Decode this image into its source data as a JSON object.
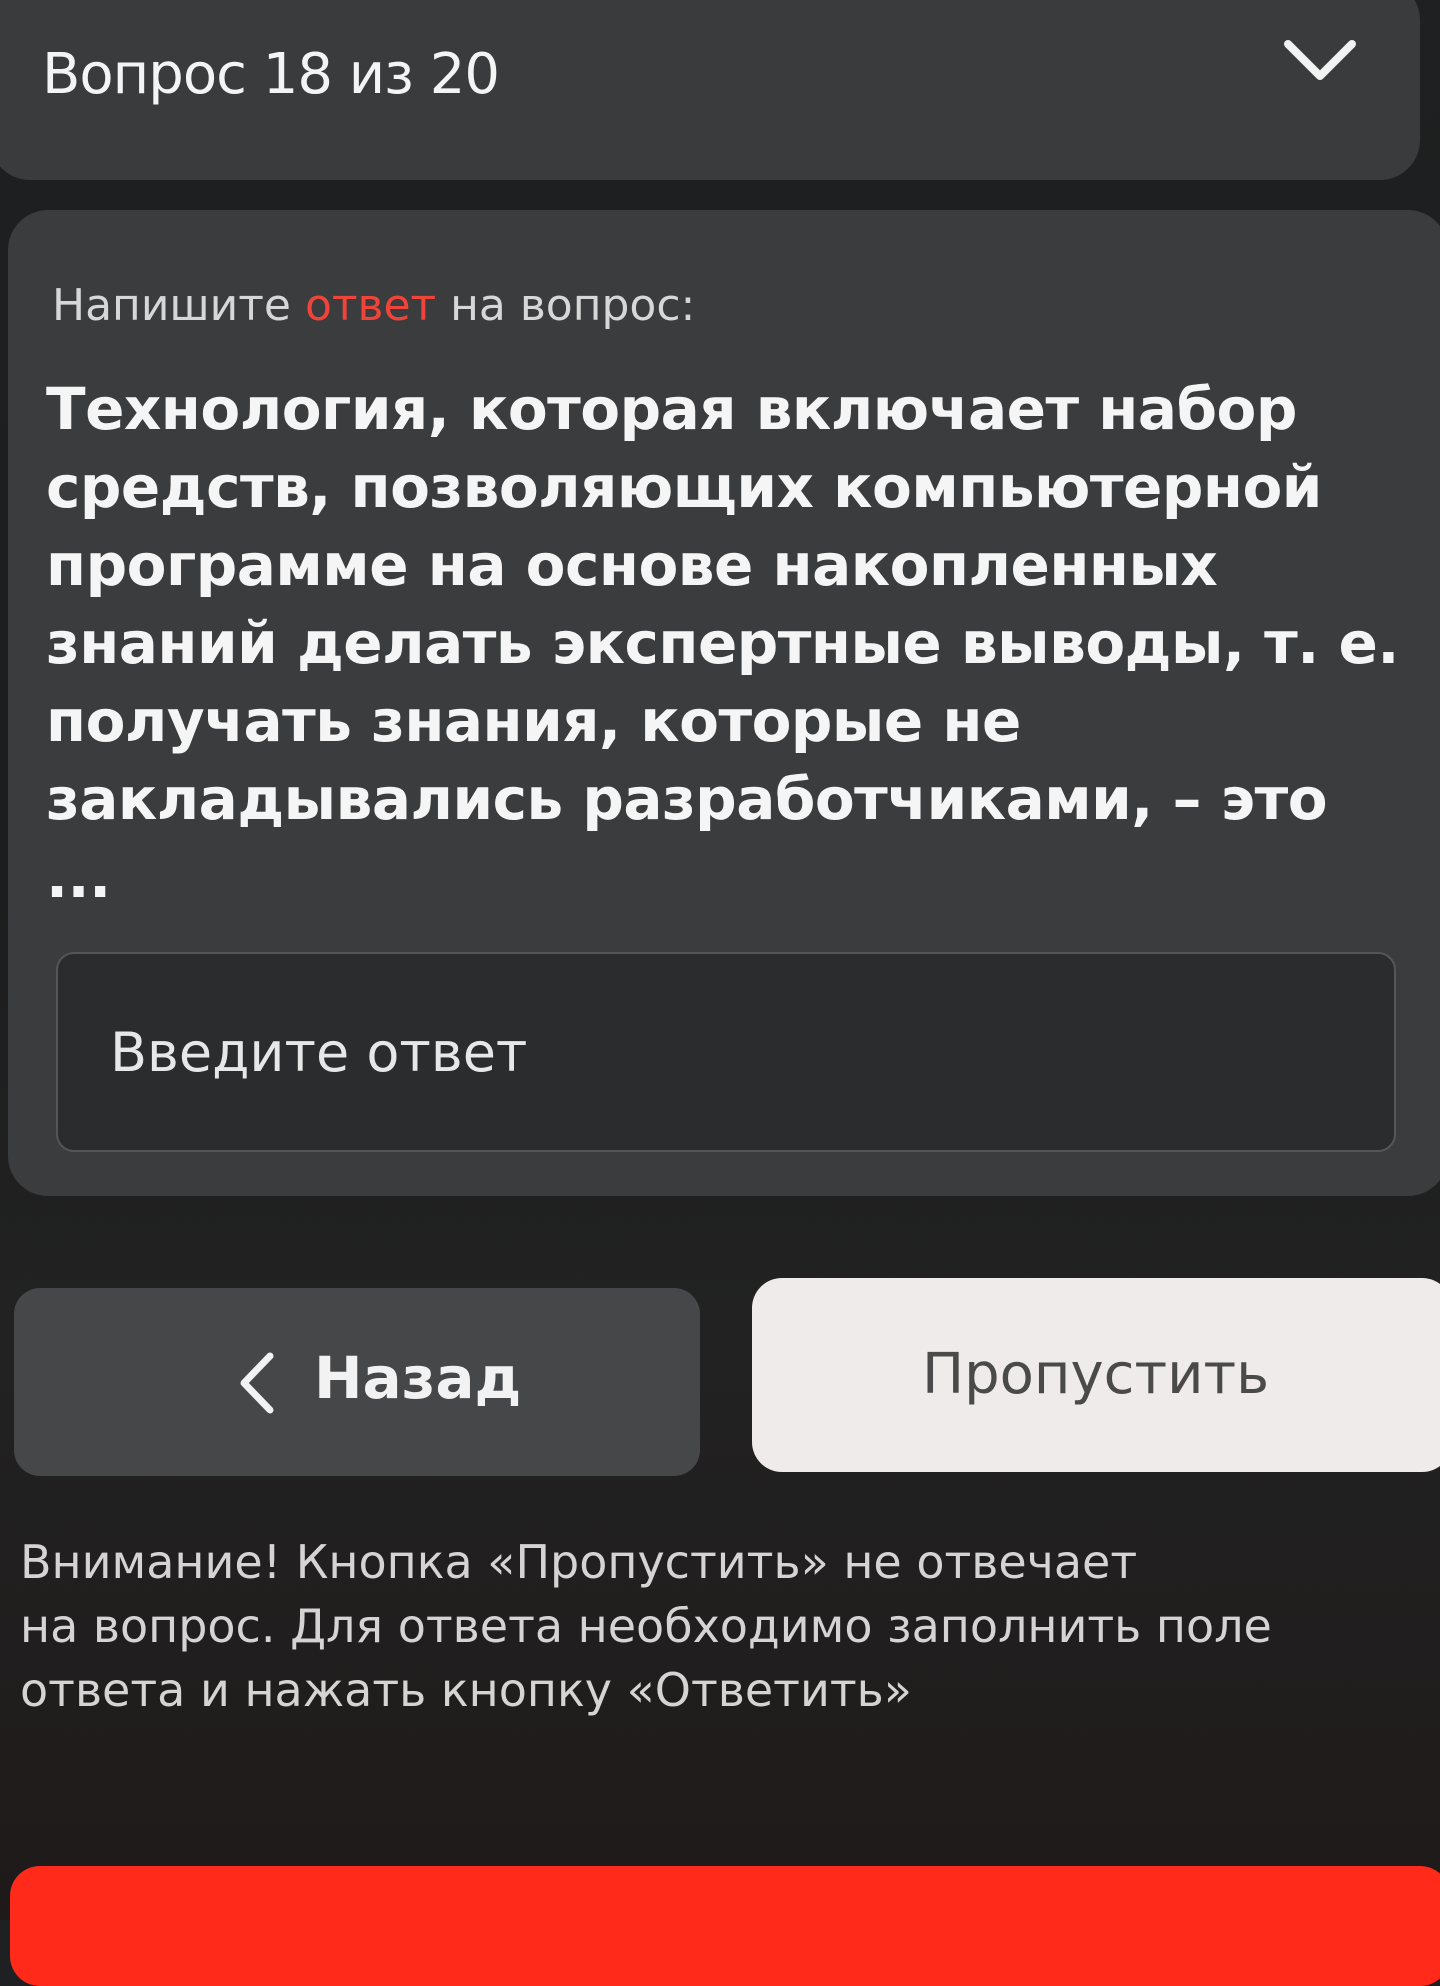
{
  "header": {
    "title": "Вопрос 18 из 20",
    "toggle_icon": "chevron-down-icon"
  },
  "question": {
    "instruction_prefix": "Напишите ",
    "instruction_accent": "ответ",
    "instruction_suffix": " на вопрос:",
    "text": "Технология, которая включает набор\nсредств, позволяющих компьютерной\nпрограмме на основе накопленных\nзнаний делать экспертные выводы, т. е.\nполучать знания, которые не\nзакладывались разработчиками, – это\n...",
    "answer_value": "",
    "answer_placeholder": "Введите ответ"
  },
  "navigation": {
    "back_icon": "chevron-left-icon",
    "back_label": "Назад",
    "skip_label": "Пропустить"
  },
  "warning_text": "Внимание! Кнопка «Пропустить» не отвечает\nна вопрос. Для ответа необходимо заполнить поле\nответа и нажать кнопку «Ответить»",
  "colors": {
    "accent": "#f0443a",
    "answer_button": "#ff2a1a",
    "card": "#3b3c3d",
    "skip_button": "#efebea"
  }
}
